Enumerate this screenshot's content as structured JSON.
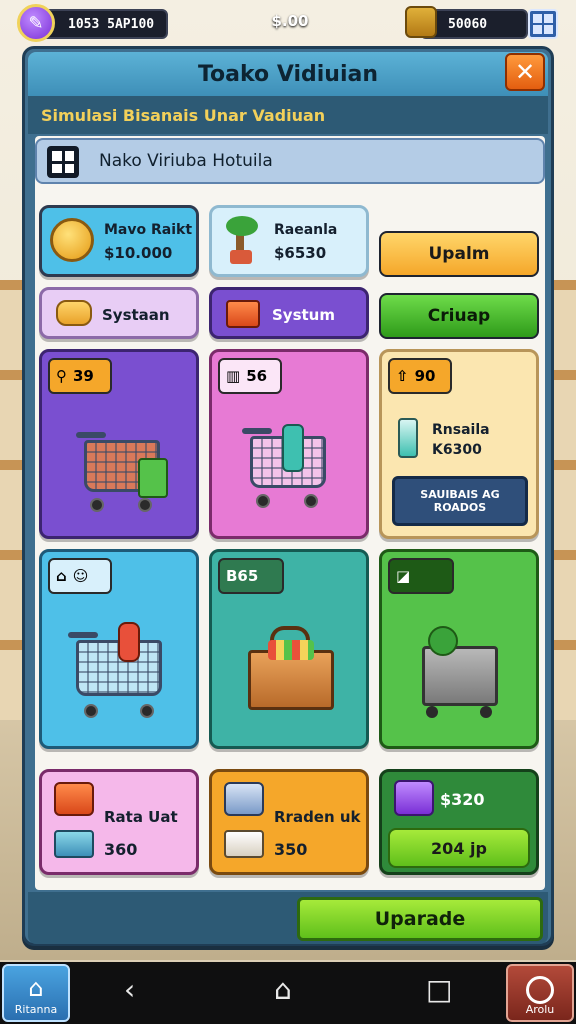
{
  "status": {
    "coins_text": "1053 5AP100",
    "money_text": "$.00",
    "gems_text": "50060"
  },
  "window": {
    "title": "Toako Vidiuian",
    "subtitle": "Simulasi Bisanais Unar Vadiuan",
    "store_name": "Nako Viriuba Hotuila"
  },
  "top_cards": [
    {
      "title": "Mavo Raikt",
      "value": "$10.000"
    },
    {
      "title": "Raeanla",
      "value": "$6530"
    }
  ],
  "action_buttons": {
    "upalm": "Upalm",
    "criuap": "Criuap"
  },
  "system_cards": [
    {
      "label": "Systaan"
    },
    {
      "label": "Systum"
    }
  ],
  "product_cards": [
    {
      "badge": "39"
    },
    {
      "badge": "56"
    },
    {
      "badge": "90",
      "name": "Rnsaila",
      "price": "K6300",
      "button": "SAUIBAIS AG ROADOS"
    },
    {
      "badge": ""
    },
    {
      "badge": "B65"
    },
    {
      "badge": ""
    }
  ],
  "bottom_cards": [
    {
      "title": "Rata Uat",
      "value": "360"
    },
    {
      "title": "Rraden uk",
      "value": "350"
    },
    {
      "title": "$320",
      "value": "204 jp"
    }
  ],
  "footer": {
    "upgrade_label": "Uparade"
  },
  "navbar": {
    "home_label": "Ritanna",
    "back_glyph": "‹",
    "home_glyph": "⌂",
    "recents_glyph": "□",
    "app_label": "Arolu"
  },
  "colors": {
    "accent_orange": "#f5a72a",
    "accent_green": "#5fbf1b",
    "purple": "#7a4fd0",
    "pink": "#e77ad4",
    "teal": "#3eb3a6"
  }
}
